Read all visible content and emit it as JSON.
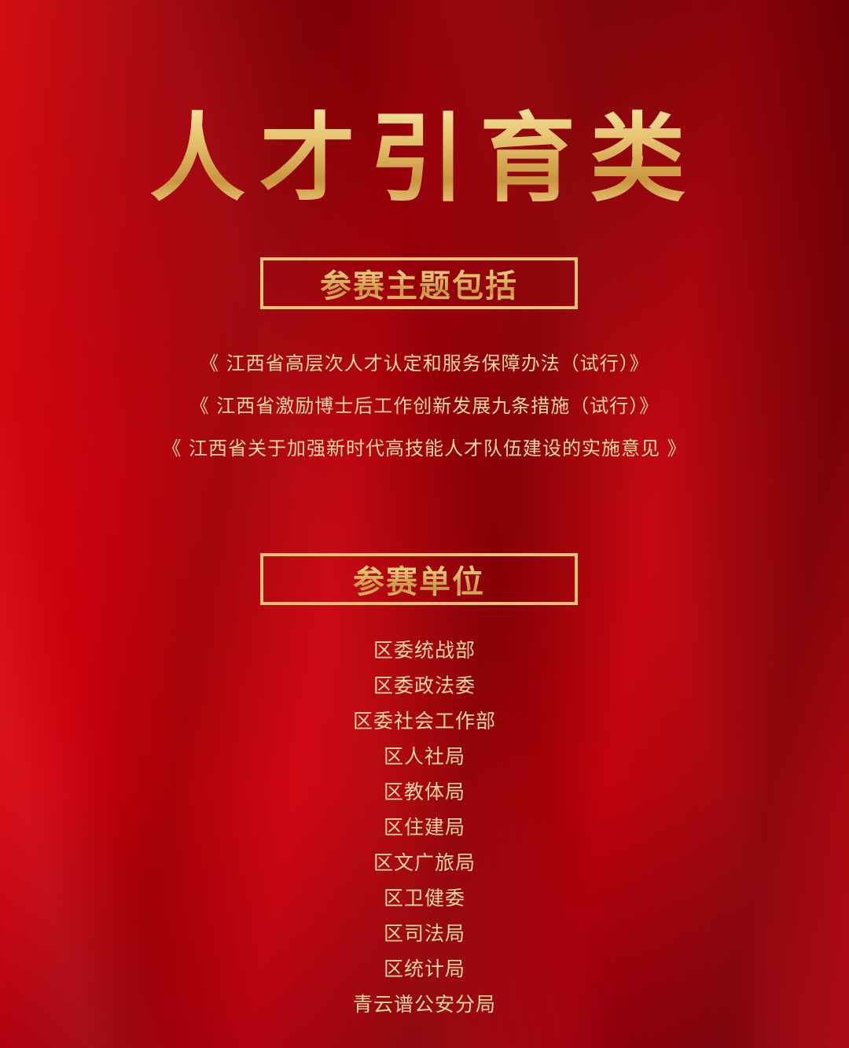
{
  "hero": {
    "title": "人才引育类"
  },
  "sections": {
    "topics": {
      "title": "参赛主题包括",
      "items": [
        "《 江西省高层次人才认定和服务保障办法（试行）》",
        "《 江西省激励博士后工作创新发展九条措施（试行）》",
        "《 江西省关于加强新时代高技能人才队伍建设的实施意见 》"
      ]
    },
    "units": {
      "title": "参赛单位",
      "items": [
        "区委统战部",
        "区委政法委",
        "区委社会工作部",
        "区人社局",
        "区教体局",
        "区住建局",
        "区文广旅局",
        "区卫健委",
        "区司法局",
        "区统计局",
        "青云谱公安分局"
      ]
    }
  },
  "colors": {
    "background": "#b0000a",
    "gold": "#e6c275",
    "text": "#f1d7a0"
  }
}
